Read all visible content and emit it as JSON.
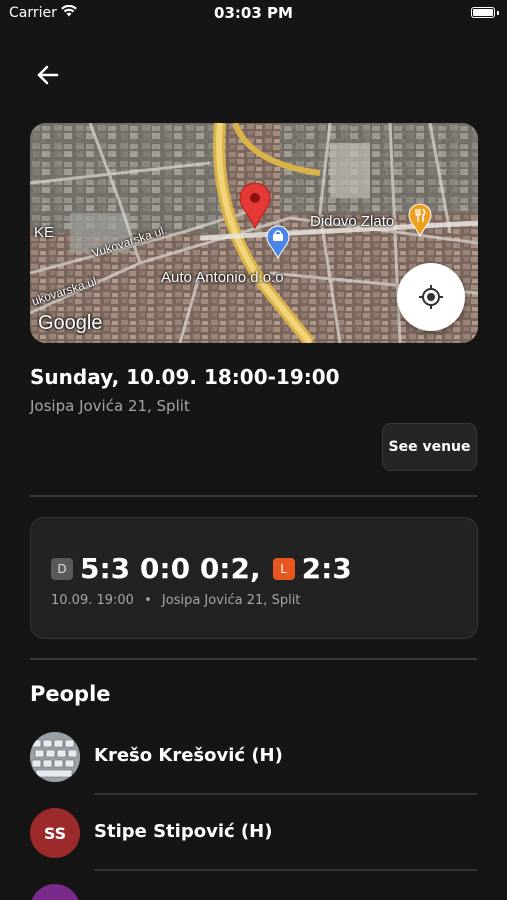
{
  "status_bar": {
    "carrier": "Carrier",
    "time": "03:03 PM"
  },
  "map": {
    "labels": {
      "place1": "Didovo Zlato",
      "place2": "Auto Antonio d.o.o",
      "street1": "Vukovarska ul.",
      "street2": "ukovarska ul.",
      "edge": "KE"
    },
    "logo": "Google",
    "pin_color": "#e53935",
    "shop_pin_color": "#4a86e8",
    "food_pin_color": "#f0a020",
    "icons": [
      "map-pin-icon",
      "shop-pin-icon",
      "restaurant-pin-icon",
      "locate-icon"
    ]
  },
  "event": {
    "title": "Sunday, 10.09. 18:00-19:00",
    "address": "Josipa Jovića 21, Split",
    "see_venue_label": "See venue"
  },
  "match": {
    "team_d_badge": "D",
    "team_d_score": "5:3 0:0 0:2,",
    "team_l_badge": "L",
    "team_l_score": "2:3",
    "meta_date": "10.09. 19:00",
    "meta_separator": "•",
    "meta_address": "Josipa Jovića 21, Split",
    "team_l_color": "#e8561f"
  },
  "people": {
    "title": "People",
    "items": [
      {
        "name": "Krešo Krešović (H)",
        "initials": "",
        "avatar_color": "#8a8f99"
      },
      {
        "name": "Stipe Stipović (H)",
        "initials": "SS",
        "avatar_color": "#9c2a2a"
      },
      {
        "name": "",
        "initials": "",
        "avatar_color": "#7a2a8a"
      }
    ]
  },
  "icons": {
    "back": "arrow-left-icon",
    "wifi": "wifi-icon",
    "battery": "battery-icon"
  }
}
